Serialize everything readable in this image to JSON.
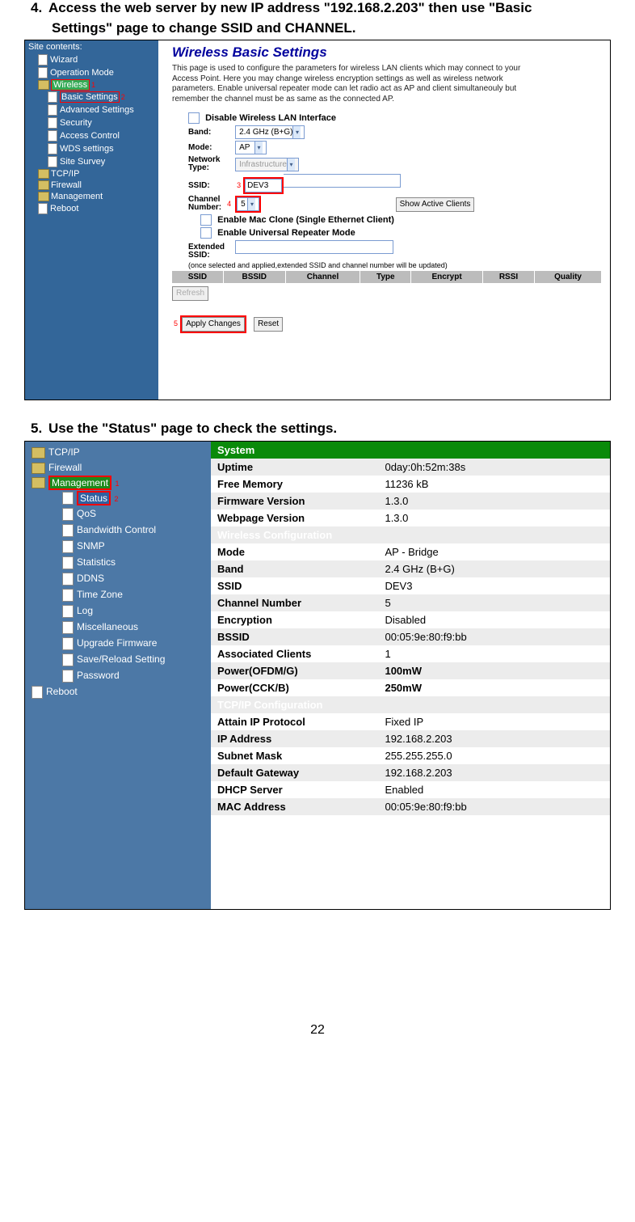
{
  "step4": {
    "heading": "Access the web server by new IP address \"192.168.2.203\" then use \"Basic",
    "heading_cont": "Settings\" page to change SSID and CHANNEL."
  },
  "step5": {
    "heading": "Use the \"Status\" page to check the settings."
  },
  "pageNumber": "22",
  "shot1": {
    "sidebar": {
      "header": "Site contents:",
      "items": [
        {
          "label": "Wizard",
          "type": "page",
          "lvl": 2
        },
        {
          "label": "Operation Mode",
          "type": "page",
          "lvl": 2
        },
        {
          "label": "Wireless",
          "type": "folder",
          "lvl": 2,
          "sel": "sel",
          "mark": "1"
        },
        {
          "label": "Basic Settings",
          "type": "page",
          "lvl": 3,
          "sel": "sel2",
          "mark": "2"
        },
        {
          "label": "Advanced Settings",
          "type": "page",
          "lvl": 3
        },
        {
          "label": "Security",
          "type": "page",
          "lvl": 3
        },
        {
          "label": "Access Control",
          "type": "page",
          "lvl": 3
        },
        {
          "label": "WDS settings",
          "type": "page",
          "lvl": 3
        },
        {
          "label": "Site Survey",
          "type": "page",
          "lvl": 3
        },
        {
          "label": "TCP/IP",
          "type": "folder",
          "lvl": 2
        },
        {
          "label": "Firewall",
          "type": "folder",
          "lvl": 2
        },
        {
          "label": "Management",
          "type": "folder",
          "lvl": 2
        },
        {
          "label": "Reboot",
          "type": "page",
          "lvl": 2
        }
      ]
    },
    "title": "Wireless Basic Settings",
    "blurb": "This page is used to configure the parameters for wireless LAN clients which may connect to your Access Point. Here you may change wireless encryption settings as well as wireless network parameters. Enable universal repeater mode can let radio act as AP and client simultaneouly but remember the channel must be as same as the connected AP.",
    "labels": {
      "disable": "Disable Wireless LAN Interface",
      "band": "Band:",
      "band_val": "2.4 GHz (B+G)",
      "mode": "Mode:",
      "mode_val": "AP",
      "nettype": "Network Type:",
      "nettype_val": "Infrastructure",
      "ssid": "SSID:",
      "ssid_val": "DEV3",
      "mark3": "3",
      "chan": "Channel Number:",
      "chan_val": "5",
      "mark4": "4",
      "show_clients": "Show Active Clients",
      "mac_clone": "Enable Mac Clone (Single Ethernet Client)",
      "univ": "Enable Universal Repeater Mode",
      "ext_ssid": "Extended SSID:",
      "note": "(once selected and applied,extended SSID and channel number will be updated)",
      "refresh": "Refresh",
      "apply": "Apply Changes",
      "reset": "Reset",
      "mark5": "5"
    },
    "table_headers": [
      "SSID",
      "BSSID",
      "Channel",
      "Type",
      "Encrypt",
      "RSSI",
      "Quality"
    ]
  },
  "shot2": {
    "sidebar": {
      "items": [
        {
          "label": "TCP/IP",
          "type": "folder",
          "lvl": 1
        },
        {
          "label": "Firewall",
          "type": "folder",
          "lvl": 1
        },
        {
          "label": "Management",
          "type": "folder",
          "lvl": 1,
          "sel": "sel-g",
          "mark": "1"
        },
        {
          "label": "Status",
          "type": "page",
          "lvl": 2,
          "sel": "sel-b",
          "mark": "2"
        },
        {
          "label": "QoS",
          "type": "page",
          "lvl": 2
        },
        {
          "label": "Bandwidth Control",
          "type": "page",
          "lvl": 2
        },
        {
          "label": "SNMP",
          "type": "page",
          "lvl": 2
        },
        {
          "label": "Statistics",
          "type": "page",
          "lvl": 2
        },
        {
          "label": "DDNS",
          "type": "page",
          "lvl": 2
        },
        {
          "label": "Time Zone",
          "type": "page",
          "lvl": 2
        },
        {
          "label": "Log",
          "type": "page",
          "lvl": 2
        },
        {
          "label": "Miscellaneous",
          "type": "page",
          "lvl": 2
        },
        {
          "label": "Upgrade Firmware",
          "type": "page",
          "lvl": 2
        },
        {
          "label": "Save/Reload Setting",
          "type": "page",
          "lvl": 2
        },
        {
          "label": "Password",
          "type": "page",
          "lvl": 2
        },
        {
          "label": "Reboot",
          "type": "page",
          "lvl": 1
        }
      ]
    },
    "sections": [
      {
        "header": "System",
        "rows": [
          {
            "k": "Uptime",
            "v": "0day:0h:52m:38s"
          },
          {
            "k": "Free Memory",
            "v": "11236 kB"
          },
          {
            "k": "Firmware Version",
            "v": "1.3.0"
          },
          {
            "k": "Webpage Version",
            "v": "1.3.0"
          }
        ]
      },
      {
        "header": "Wireless Configuration",
        "rows": [
          {
            "k": "Mode",
            "v": "AP - Bridge"
          },
          {
            "k": "Band",
            "v": "2.4 GHz (B+G)"
          },
          {
            "k": "SSID",
            "v": "DEV3"
          },
          {
            "k": "Channel Number",
            "v": "5"
          },
          {
            "k": "Encryption",
            "v": "Disabled"
          },
          {
            "k": "BSSID",
            "v": "00:05:9e:80:f9:bb"
          },
          {
            "k": "Associated Clients",
            "v": "1"
          },
          {
            "k": "Power(OFDM/G)",
            "v": "100mW",
            "bold": true
          },
          {
            "k": "Power(CCK/B)",
            "v": "250mW",
            "bold": true
          }
        ]
      },
      {
        "header": "TCP/IP Configuration",
        "rows": [
          {
            "k": "Attain IP Protocol",
            "v": "Fixed IP"
          },
          {
            "k": "IP Address",
            "v": "192.168.2.203"
          },
          {
            "k": "Subnet Mask",
            "v": "255.255.255.0"
          },
          {
            "k": "Default Gateway",
            "v": "192.168.2.203"
          },
          {
            "k": "DHCP Server",
            "v": "Enabled"
          },
          {
            "k": "MAC Address",
            "v": "00:05:9e:80:f9:bb"
          }
        ]
      }
    ]
  }
}
